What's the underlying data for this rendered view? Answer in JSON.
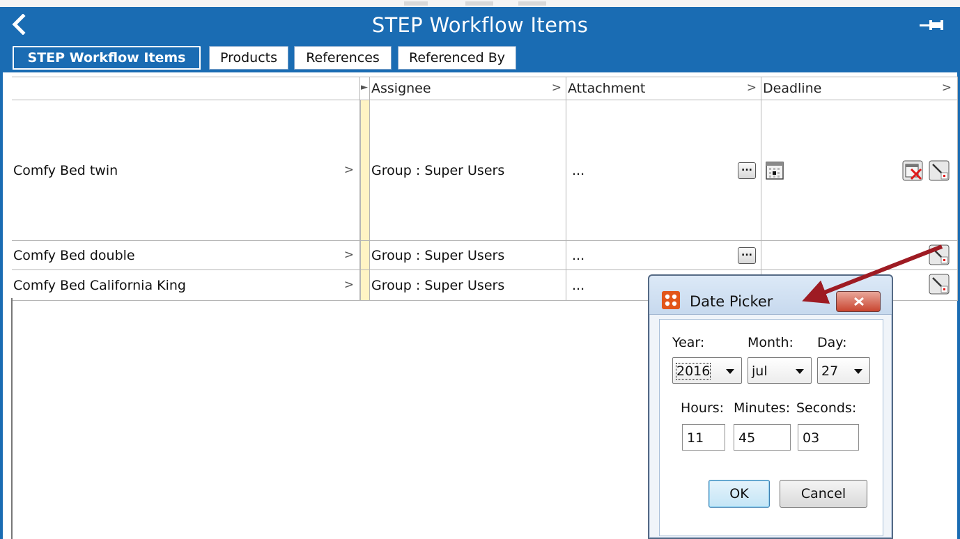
{
  "window": {
    "title": "STEP Workflow Items"
  },
  "tabs": [
    {
      "label": "STEP Workflow Items",
      "active": true
    },
    {
      "label": "Products",
      "active": false
    },
    {
      "label": "References",
      "active": false
    },
    {
      "label": "Referenced By",
      "active": false
    }
  ],
  "table": {
    "columns": [
      "",
      "Assignee",
      "Attachment",
      "Deadline"
    ],
    "rows": [
      {
        "name": "Comfy Bed twin",
        "assignee": "Group : Super Users",
        "attachment": "..."
      },
      {
        "name": "Comfy Bed double",
        "assignee": "Group : Super Users",
        "attachment": "..."
      },
      {
        "name": "Comfy Bed California King",
        "assignee": "Group : Super Users",
        "attachment": "..."
      }
    ],
    "chevron": ">",
    "ellipsis_button": "..."
  },
  "dialog": {
    "title": "Date Picker",
    "year_label": "Year:",
    "month_label": "Month:",
    "day_label": "Day:",
    "year": "2016",
    "month": "jul",
    "day": "27",
    "hours_label": "Hours:",
    "minutes_label": "Minutes:",
    "seconds_label": "Seconds:",
    "hours": "11",
    "minutes": "45",
    "seconds": "03",
    "ok_label": "OK",
    "cancel_label": "Cancel"
  },
  "colors": {
    "accent": "#1a6cb3",
    "highlight_column": "#fff4c4",
    "annotation_arrow": "#9e1b23"
  },
  "icons": [
    "back-icon",
    "pin-icon",
    "calendar-icon",
    "clear-date-icon",
    "edit-date-icon",
    "app-icon",
    "close-icon"
  ]
}
